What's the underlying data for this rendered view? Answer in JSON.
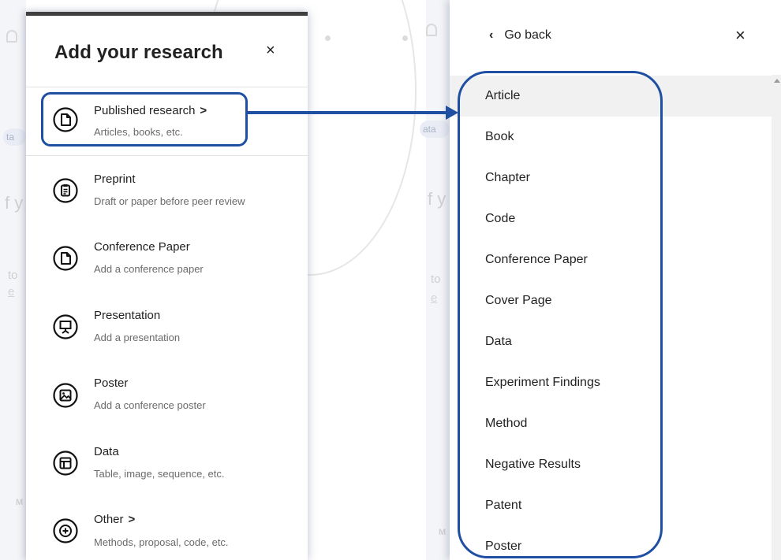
{
  "background": {
    "chip_left": "ta",
    "chip_right": "ata",
    "ghost_left": "f y",
    "ghost_right": "f y",
    "to_left": "to",
    "to_right": "to",
    "link_left": "e",
    "link_right": "e",
    "m_left": "M",
    "m_right": "M"
  },
  "left_panel": {
    "title": "Add your research",
    "close_label": "×",
    "items": [
      {
        "title": "Published research",
        "subtitle": "Articles, books, etc.",
        "icon": "document-icon",
        "has_chevron": true
      },
      {
        "title": "Preprint",
        "subtitle": "Draft or paper before peer review",
        "icon": "clipboard-icon"
      },
      {
        "title": "Conference Paper",
        "subtitle": "Add a conference paper",
        "icon": "document-icon"
      },
      {
        "title": "Presentation",
        "subtitle": "Add a presentation",
        "icon": "presentation-icon"
      },
      {
        "title": "Poster",
        "subtitle": "Add a conference poster",
        "icon": "image-icon"
      },
      {
        "title": "Data",
        "subtitle": "Table, image, sequence, etc.",
        "icon": "layout-icon"
      },
      {
        "title": "Other",
        "subtitle": "Methods, proposal, code, etc.",
        "icon": "plus-circle-icon",
        "has_chevron": true
      }
    ]
  },
  "right_panel": {
    "back_label": "Go back",
    "back_icon": "‹",
    "close_label": "×",
    "items": [
      "Article",
      "Book",
      "Chapter",
      "Code",
      "Conference Paper",
      "Cover Page",
      "Data",
      "Experiment Findings",
      "Method",
      "Negative Results",
      "Patent",
      "Poster"
    ]
  },
  "colors": {
    "highlight": "#1e4fa3",
    "hover_row": "#f1f1f1",
    "text": "#222222",
    "subtext": "#6a6a6a"
  }
}
